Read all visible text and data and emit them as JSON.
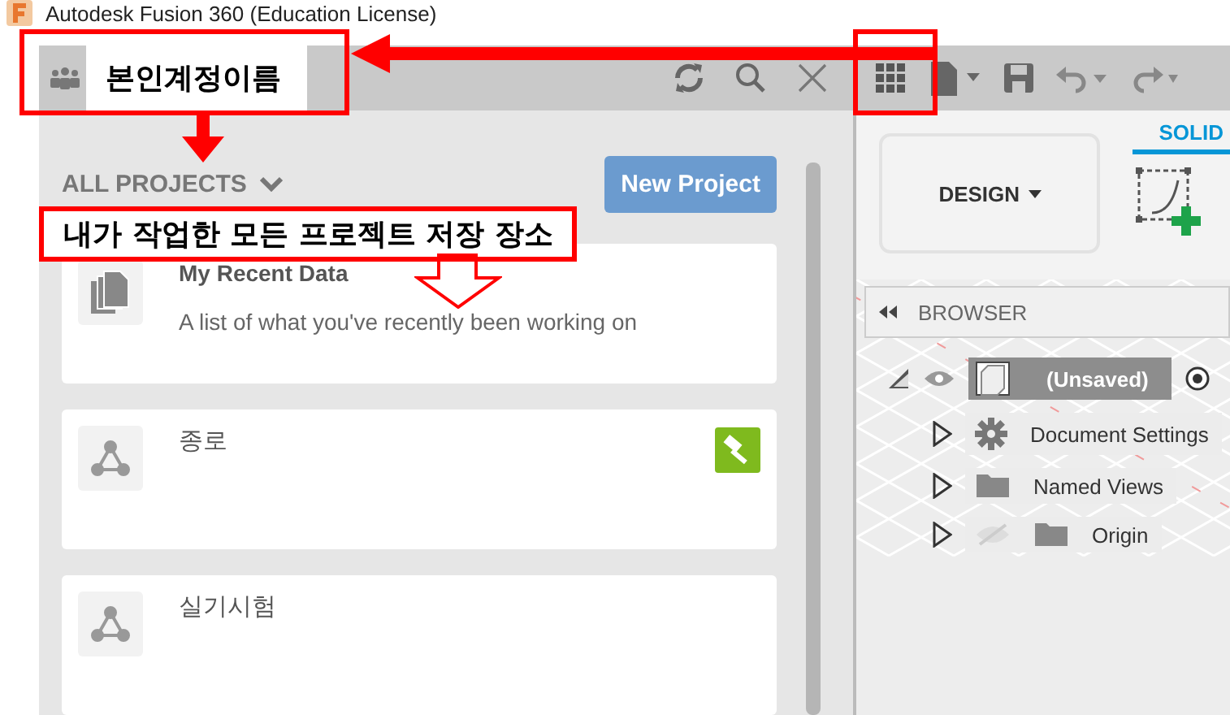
{
  "window": {
    "title": "Autodesk Fusion 360 (Education License)"
  },
  "data_panel": {
    "project_filter": "ALL PROJECTS",
    "new_project_button": "New Project",
    "projects": [
      {
        "kind": "recent",
        "name": "My Recent Data",
        "description": "A list of what you've recently been working on",
        "badge": false
      },
      {
        "kind": "project",
        "name": "종로",
        "badge": true
      },
      {
        "kind": "project",
        "name": "실기시험",
        "badge": false
      }
    ]
  },
  "workspace": {
    "workspace_button": "DESIGN",
    "tabs": [
      {
        "label": "SOLID",
        "selected": true
      }
    ]
  },
  "browser": {
    "title": "BROWSER",
    "root": {
      "label": "(Unsaved)",
      "children": [
        {
          "kind": "settings",
          "label": "Document Settings",
          "visible": true
        },
        {
          "kind": "folder",
          "label": "Named Views",
          "visible": true
        },
        {
          "kind": "folder",
          "label": "Origin",
          "visible": false
        }
      ]
    }
  },
  "annotations": [
    {
      "kind": "account",
      "text": "본인계정이름"
    },
    {
      "kind": "projects",
      "text": "내가 작업한 모든 프로젝트 저장 장소"
    }
  ]
}
